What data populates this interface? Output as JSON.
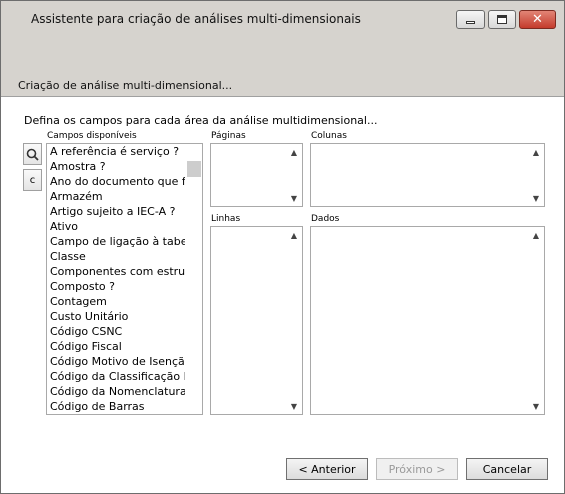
{
  "window": {
    "title": "Assistente para criação de análises multi-dimensionais",
    "controls": {
      "minimize": "minimize-icon",
      "maximize": "maximize-icon",
      "close": "close-icon"
    }
  },
  "header": {
    "title": "Criação de análise multi-dimensional..."
  },
  "instruction": "Defina os campos para cada área da análise multidimensional...",
  "available_fields": {
    "label": "Campos disponíveis",
    "items": [
      "A referência é serviço ?",
      "Amostra ?",
      "Ano do documento que faz",
      "Armazém",
      "Artigo sujeito a IEC-A ?",
      "Ativo",
      "Campo de ligação à tabela",
      "Classe",
      "Componentes com estrutura",
      "Composto ?",
      "Contagem",
      "Custo Unitário",
      "Código CSNC",
      "Código Fiscal",
      "Código Motivo de Isenção",
      "Código da Classificação Es",
      "Código da Nomenclatura C",
      "Código de Barras"
    ]
  },
  "side_buttons": {
    "search_icon": "search-icon",
    "c_label": "c"
  },
  "areas": {
    "paginas": "Páginas",
    "colunas": "Colunas",
    "linhas": "Linhas",
    "dados": "Dados"
  },
  "footer": {
    "back_label": "< Anterior",
    "next_label": "Próximo >",
    "cancel_label": "Cancelar"
  }
}
